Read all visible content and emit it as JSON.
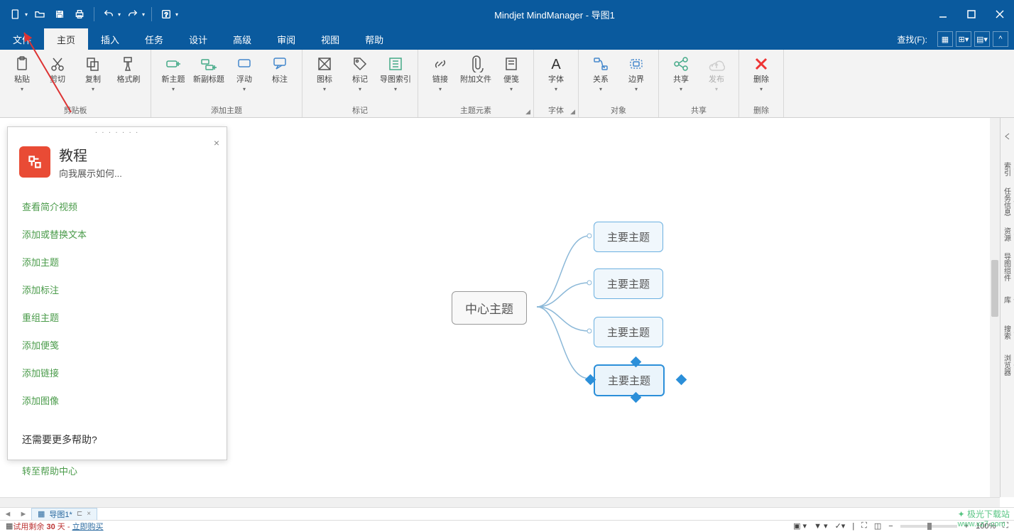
{
  "app": {
    "title": "Mindjet MindManager - 导图1"
  },
  "menus": {
    "file": "文件",
    "home": "主页",
    "insert": "插入",
    "task": "任务",
    "design": "设计",
    "advanced": "高级",
    "review": "审阅",
    "view": "视图",
    "help": "帮助",
    "find": "查找(F):"
  },
  "ribbon": {
    "clipboard": {
      "label": "剪贴板",
      "paste": "粘贴",
      "cut": "剪切",
      "copy": "复制",
      "format_painter": "格式刷"
    },
    "add_topic": {
      "label": "添加主题",
      "new_topic": "新主题",
      "new_subtitle": "新副标题",
      "float": "浮动",
      "callout": "标注"
    },
    "markers": {
      "label": "标记",
      "icon": "图标",
      "tag": "标记",
      "map_index": "导图索引"
    },
    "elements": {
      "label": "主题元素",
      "link": "链接",
      "attach": "附加文件",
      "notes": "便笺"
    },
    "font": {
      "label": "字体",
      "font": "字体"
    },
    "object": {
      "label": "对象",
      "relation": "关系",
      "boundary": "边界"
    },
    "share": {
      "label": "共享",
      "share": "共享",
      "publish": "发布"
    },
    "delete": {
      "label": "删除",
      "delete": "删除"
    }
  },
  "tutorial": {
    "title": "教程",
    "subtitle": "向我展示如何...",
    "links": {
      "video": "查看简介视频",
      "replace_text": "添加或替换文本",
      "add_topic": "添加主题",
      "add_callout": "添加标注",
      "reorg": "重组主题",
      "add_note": "添加便笺",
      "add_link": "添加链接",
      "add_image": "添加图像"
    },
    "more_q": "还需要更多帮助?",
    "help_center": "转至帮助中心"
  },
  "mindmap": {
    "center": "中心主题",
    "topic1": "主要主题",
    "topic2": "主要主题",
    "topic3": "主要主题",
    "topic4": "主要主题"
  },
  "sidepanel": {
    "index": "索引",
    "taskinfo": "任务信息",
    "resource": "资源",
    "parts": "导图组件",
    "library": "库",
    "search": "搜索",
    "browser": "浏览器"
  },
  "tabs": {
    "doc1": "导图1*"
  },
  "status": {
    "trial_prefix": "试用剩余 ",
    "trial_days": "30",
    "trial_suffix": " 天 - ",
    "buy": "立即购买",
    "zoom": "100%"
  },
  "watermark": {
    "name": "极光下载站",
    "url": "www.xz7.com"
  }
}
